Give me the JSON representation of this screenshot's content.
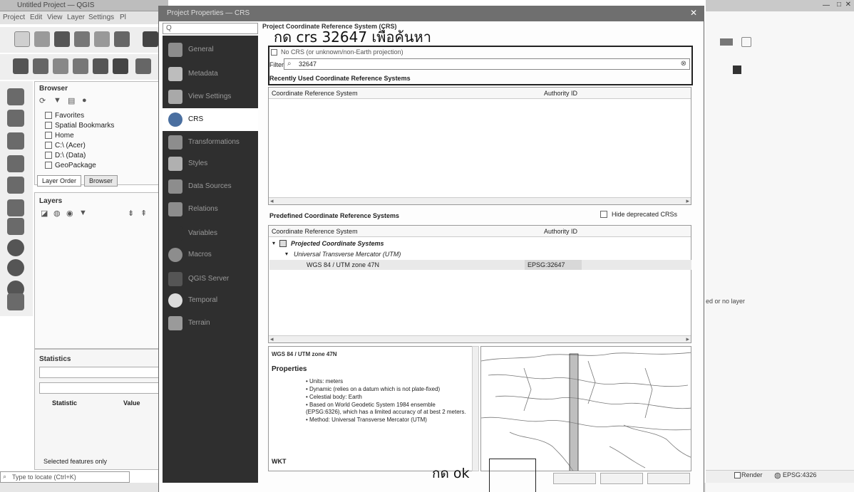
{
  "main_window": {
    "title": "Untitled Project — QGIS",
    "menu": [
      "Project",
      "Edit",
      "View",
      "Layer",
      "Settings",
      "Pl"
    ],
    "browser": {
      "title": "Browser",
      "items": [
        "Favorites",
        "Spatial Bookmarks",
        "Home",
        "C:\\ (Acer)",
        "D:\\ (Data)",
        "GeoPackage"
      ]
    },
    "tabs": [
      "Layer Order",
      "Browser"
    ],
    "layers_title": "Layers",
    "statistics": {
      "title": "Statistics",
      "col_statistic": "Statistic",
      "col_value": "Value",
      "selected_only": "Selected features only"
    },
    "locator_placeholder": "Type to locate (Ctrl+K)",
    "right_status": {
      "render": "Render",
      "crs": "EPSG:4326",
      "no_layer": "ed or no layer"
    }
  },
  "dialog": {
    "title": "Project Properties — CRS",
    "search_placeholder": "Q",
    "sidebar": [
      {
        "label": "General",
        "icon": "wrench-icon"
      },
      {
        "label": "Metadata",
        "icon": "metadata-icon"
      },
      {
        "label": "View Settings",
        "icon": "view-icon"
      },
      {
        "label": "CRS",
        "icon": "globe-icon",
        "active": true
      },
      {
        "label": "Transformations",
        "icon": "transform-icon"
      },
      {
        "label": "Styles",
        "icon": "styles-icon"
      },
      {
        "label": "Data Sources",
        "icon": "table-icon"
      },
      {
        "label": "Relations",
        "icon": "relations-icon"
      },
      {
        "label": "Variables",
        "icon": "variables-icon"
      },
      {
        "label": "Macros",
        "icon": "macros-icon"
      },
      {
        "label": "QGIS Server",
        "icon": "server-icon"
      },
      {
        "label": "Temporal",
        "icon": "clock-icon"
      },
      {
        "label": "Terrain",
        "icon": "terrain-icon"
      }
    ],
    "content_title": "Project Coordinate Reference System (CRS)",
    "annotation_top": "กด crs 32647 เพื่อค้นหา",
    "no_crs_label": "No CRS (or unknown/non-Earth projection)",
    "filter_label": "Filter",
    "filter_value": "32647",
    "recent_label": "Recently Used Coordinate Reference Systems",
    "table_headers": {
      "crs": "Coordinate Reference System",
      "authority": "Authority ID"
    },
    "predefined_label": "Predefined Coordinate Reference Systems",
    "hide_deprecated": "Hide deprecated CRSs",
    "predefined_rows": [
      {
        "label": "Projected Coordinate Systems",
        "level": 0,
        "auth": ""
      },
      {
        "label": "Universal Transverse Mercator (UTM)",
        "level": 1,
        "auth": ""
      },
      {
        "label": "WGS 84 / UTM zone 47N",
        "level": 2,
        "auth": "EPSG:32647"
      }
    ],
    "info": {
      "title": "WGS 84 / UTM zone 47N",
      "properties_heading": "Properties",
      "properties": [
        "Units: meters",
        "Dynamic (relies on a datum which is not plate-fixed)",
        "Celestial body: Earth",
        "Based on World Geodetic System 1984 ensemble (EPSG:6326), which has a limited accuracy of at best 2 meters.",
        "Method: Universal Transverse Mercator (UTM)"
      ],
      "wkt_label": "WKT"
    },
    "annotation_ok": "กด ok"
  }
}
